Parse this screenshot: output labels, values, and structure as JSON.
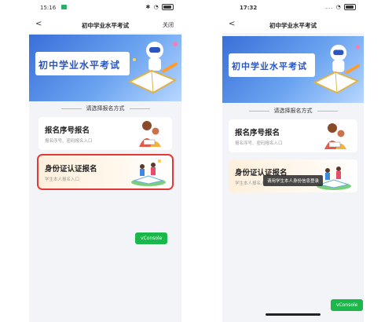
{
  "left": {
    "status": {
      "time": "15:16"
    },
    "nav": {
      "back": "<",
      "title": "初中学业水平考试",
      "close": "关闭"
    },
    "banner": {
      "title": "初中学业水平考试"
    },
    "section_title": "请选择报名方式",
    "options": [
      {
        "title": "报名序号报名",
        "subtitle": "报名序号、密码报名入口"
      },
      {
        "title": "身份证认证报名",
        "subtitle": "学生本人报名入口"
      }
    ],
    "vconsole": "vConsole"
  },
  "right": {
    "status": {
      "time": "17:32"
    },
    "nav": {
      "back": "<",
      "title": "初中学业水平考试"
    },
    "banner": {
      "title": "初中学业水平考试"
    },
    "section_title": "请选择报名方式",
    "options": [
      {
        "title": "报名序号报名",
        "subtitle": "报名序号、密码报名入口"
      },
      {
        "title": "身份证认证报名",
        "subtitle": "学生本人报名入口"
      }
    ],
    "toast": "请用学生本人身份信息登录",
    "vconsole": "vConsole"
  },
  "colors": {
    "accent": "#3a6fd8",
    "selected_border": "#e53935",
    "vconsole": "#1bb74b"
  },
  "icons": [
    "back-chevron-icon",
    "wifi-icon",
    "battery-icon",
    "robot-icon",
    "book-icon",
    "mother-child-icon",
    "children-reading-icon"
  ]
}
